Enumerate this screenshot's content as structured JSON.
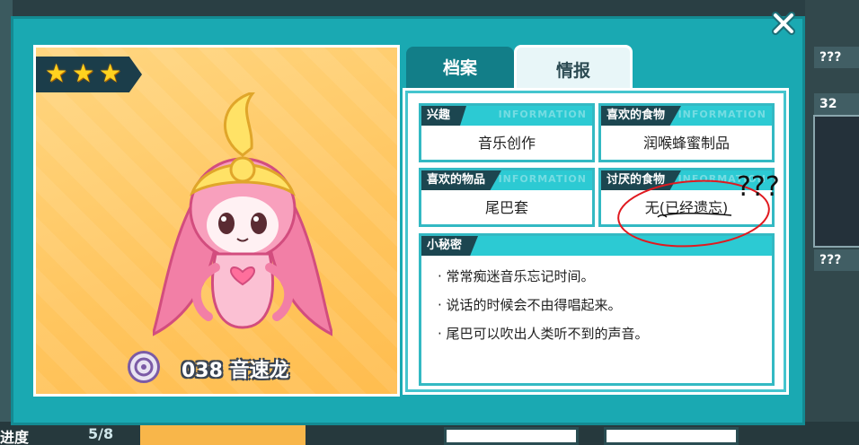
{
  "background": {
    "right_labels": [
      "???",
      "32",
      "???"
    ],
    "bottom": {
      "label": "进度",
      "count": "5/8"
    }
  },
  "dialog": {
    "close_label": "✕",
    "portrait": {
      "stars": 3,
      "character_number": "038",
      "character_name": "音速龙",
      "number_and_name": "038 音速龙"
    },
    "tabs": [
      {
        "label": "档案",
        "active": false
      },
      {
        "label": "情报",
        "active": true
      }
    ],
    "info": {
      "watermark": "INFORMATION",
      "hobby": {
        "label": "兴趣",
        "value": "音乐创作"
      },
      "favorite_food": {
        "label": "喜欢的食物",
        "value": "润喉蜂蜜制品"
      },
      "favorite_item": {
        "label": "喜欢的物品",
        "value": "尾巴套"
      },
      "disliked_food": {
        "label": "讨厌的食物",
        "value": "无(已经遗忘)"
      },
      "secret": {
        "label": "小秘密",
        "lines": [
          "· 常常痴迷音乐忘记时间。",
          "· 说话的时候会不由得唱起来。",
          "· 尾巴可以吹出人类听不到的声音。"
        ]
      }
    },
    "annotation": {
      "text": "???",
      "color": "#e0191f"
    }
  },
  "colors": {
    "dialog_teal": "#1aa9b2",
    "portrait_bg": "#ffc55e",
    "box_border": "#33b9c3",
    "label_dark": "#1c4650",
    "star": "#ffd21f"
  }
}
